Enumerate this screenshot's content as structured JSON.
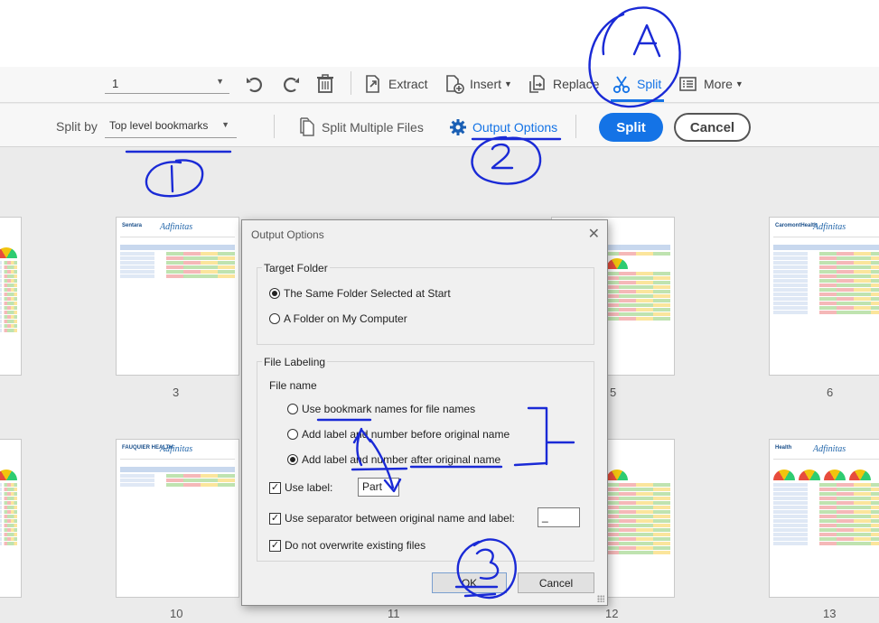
{
  "toolbar": {
    "page_value": "1",
    "extract_label": "Extract",
    "insert_label": "Insert",
    "replace_label": "Replace",
    "split_label": "Split",
    "more_label": "More",
    "accent": "#1473e6"
  },
  "splitbar": {
    "split_by_label": "Split by",
    "split_by_value": "Top level bookmarks",
    "split_multiple_label": "Split Multiple Files",
    "output_options_label": "Output Options",
    "split_button": "Split",
    "cancel_button": "Cancel"
  },
  "pages": {
    "labels": [
      "3",
      "5",
      "6",
      "10",
      "11",
      "12",
      "13"
    ]
  },
  "dialog": {
    "title": "Output Options",
    "target_folder": {
      "label": "Target Folder",
      "options": [
        "The Same Folder Selected at Start",
        "A Folder on My Computer"
      ],
      "selected_index": 0
    },
    "file_labeling": {
      "label": "File Labeling",
      "file_name_label": "File name",
      "options": [
        "Use bookmark names for file names",
        "Add label and number before original name",
        "Add label and number after original name"
      ],
      "selected_index": 2,
      "use_label": {
        "label": "Use label:",
        "checked": true,
        "value": "Part"
      },
      "use_separator": {
        "label": "Use separator between original name and label:",
        "checked": true,
        "value": "_"
      },
      "no_overwrite": {
        "label": "Do not overwrite existing files",
        "checked": true
      }
    },
    "ok_button": "OK",
    "cancel_button": "Cancel"
  },
  "annotations": {
    "color": "#1a2ad6",
    "labels": [
      "A",
      "1",
      "2",
      "3"
    ]
  }
}
